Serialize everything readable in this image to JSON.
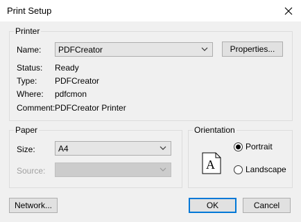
{
  "window": {
    "title": "Print Setup"
  },
  "printer": {
    "legend": "Printer",
    "name_label": "Name:",
    "name_value": "PDFCreator",
    "properties_label": "Properties...",
    "status_label": "Status:",
    "status_value": "Ready",
    "type_label": "Type:",
    "type_value": "PDFCreator",
    "where_label": "Where:",
    "where_value": "pdfcmon",
    "comment_label": "Comment:",
    "comment_value": "PDFCreator Printer"
  },
  "paper": {
    "legend": "Paper",
    "size_label": "Size:",
    "size_value": "A4",
    "source_label": "Source:",
    "source_value": ""
  },
  "orientation": {
    "legend": "Orientation",
    "preview_letter": "A",
    "portrait_label": "Portrait",
    "landscape_label": "Landscape",
    "selected": "Portrait"
  },
  "buttons": {
    "network_label": "Network...",
    "ok_label": "OK",
    "cancel_label": "Cancel"
  }
}
